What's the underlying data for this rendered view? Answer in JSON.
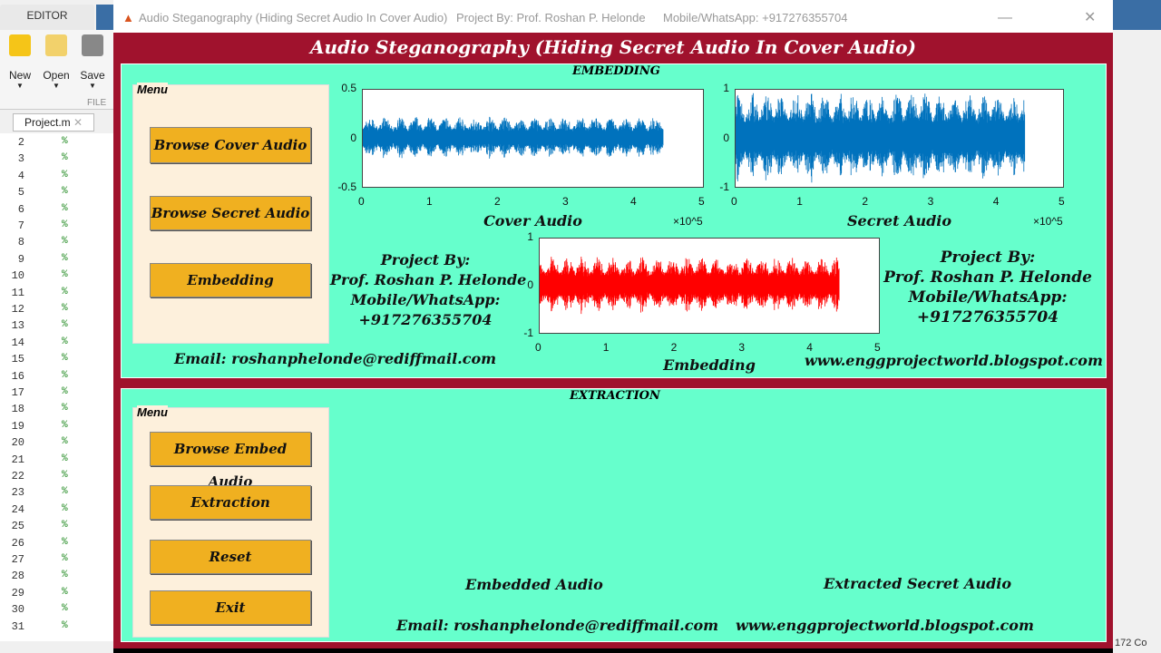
{
  "editor": {
    "tab": "EDITOR",
    "tools": [
      {
        "label": "New",
        "icon": "plus-icon"
      },
      {
        "label": "Open",
        "icon": "folder-icon"
      },
      {
        "label": "Save",
        "icon": "save-icon"
      }
    ],
    "section": "FILE",
    "file_tab": "Project.m",
    "line_numbers": [
      "2",
      "3",
      "4",
      "5",
      "6",
      "7",
      "8",
      "9",
      "10",
      "11",
      "12",
      "13",
      "14",
      "15",
      "16",
      "17",
      "18",
      "19",
      "20",
      "21",
      "22",
      "23",
      "24",
      "25",
      "26",
      "27",
      "28",
      "29",
      "30",
      "31"
    ],
    "comment_char": "%",
    "status_right": "172 Co"
  },
  "window": {
    "title": "Audio Steganography (Hiding Secret Audio In Cover Audio)",
    "project": "Project By: Prof. Roshan P. Helonde",
    "mobile": "Mobile/WhatsApp: +917276355704"
  },
  "main_title": "Audio Steganography (Hiding Secret Audio In Cover Audio)",
  "embedding": {
    "title": "EMBEDDING",
    "menu_label": "Menu",
    "buttons": [
      "Browse Cover Audio",
      "Browse Secret Audio",
      "Embedding"
    ],
    "project_text": [
      "Project By:",
      "Prof. Roshan P. Helonde",
      "Mobile/WhatsApp:",
      "+917276355704"
    ],
    "email": "Email: roshanphelonde@rediffmail.com",
    "website": "www.enggprojectworld.blogspot.com"
  },
  "extraction": {
    "title": "EXTRACTION",
    "menu_label": "Menu",
    "buttons": [
      "Browse Embed Audio",
      "Extraction",
      "Reset",
      "Exit"
    ],
    "embedded_label": "Embedded Audio",
    "extracted_label": "Extracted Secret Audio",
    "email": "Email: roshanphelonde@rediffmail.com",
    "website": "www.enggprojectworld.blogspot.com"
  },
  "chart_data": [
    {
      "type": "line",
      "xlabel": "Cover Audio",
      "x_multiplier": "×10^5",
      "xlim": [
        0,
        5
      ],
      "ylim": [
        -0.5,
        0.5
      ],
      "xticks": [
        "0",
        "1",
        "2",
        "3",
        "4",
        "5"
      ],
      "yticks": [
        "-0.5",
        "0",
        "0.5"
      ],
      "x_extent": [
        0,
        4.42
      ],
      "color": "#0072bd",
      "amplitude": 0.2
    },
    {
      "type": "line",
      "xlabel": "Secret Audio",
      "x_multiplier": "×10^5",
      "xlim": [
        0,
        5
      ],
      "ylim": [
        -1,
        1
      ],
      "xticks": [
        "0",
        "1",
        "2",
        "3",
        "4",
        "5"
      ],
      "yticks": [
        "-1",
        "0",
        "1"
      ],
      "x_extent": [
        0,
        4.42
      ],
      "color": "#0072bd",
      "amplitude": 0.85
    },
    {
      "type": "line",
      "xlabel": "Embedding",
      "xlim": [
        0,
        5
      ],
      "ylim": [
        -1,
        1
      ],
      "xticks": [
        "0",
        "1",
        "2",
        "3",
        "4",
        "5"
      ],
      "yticks": [
        "-1",
        "0",
        "1"
      ],
      "x_extent": [
        0,
        4.42
      ],
      "color": "#ff0000",
      "amplitude": 0.55
    }
  ]
}
